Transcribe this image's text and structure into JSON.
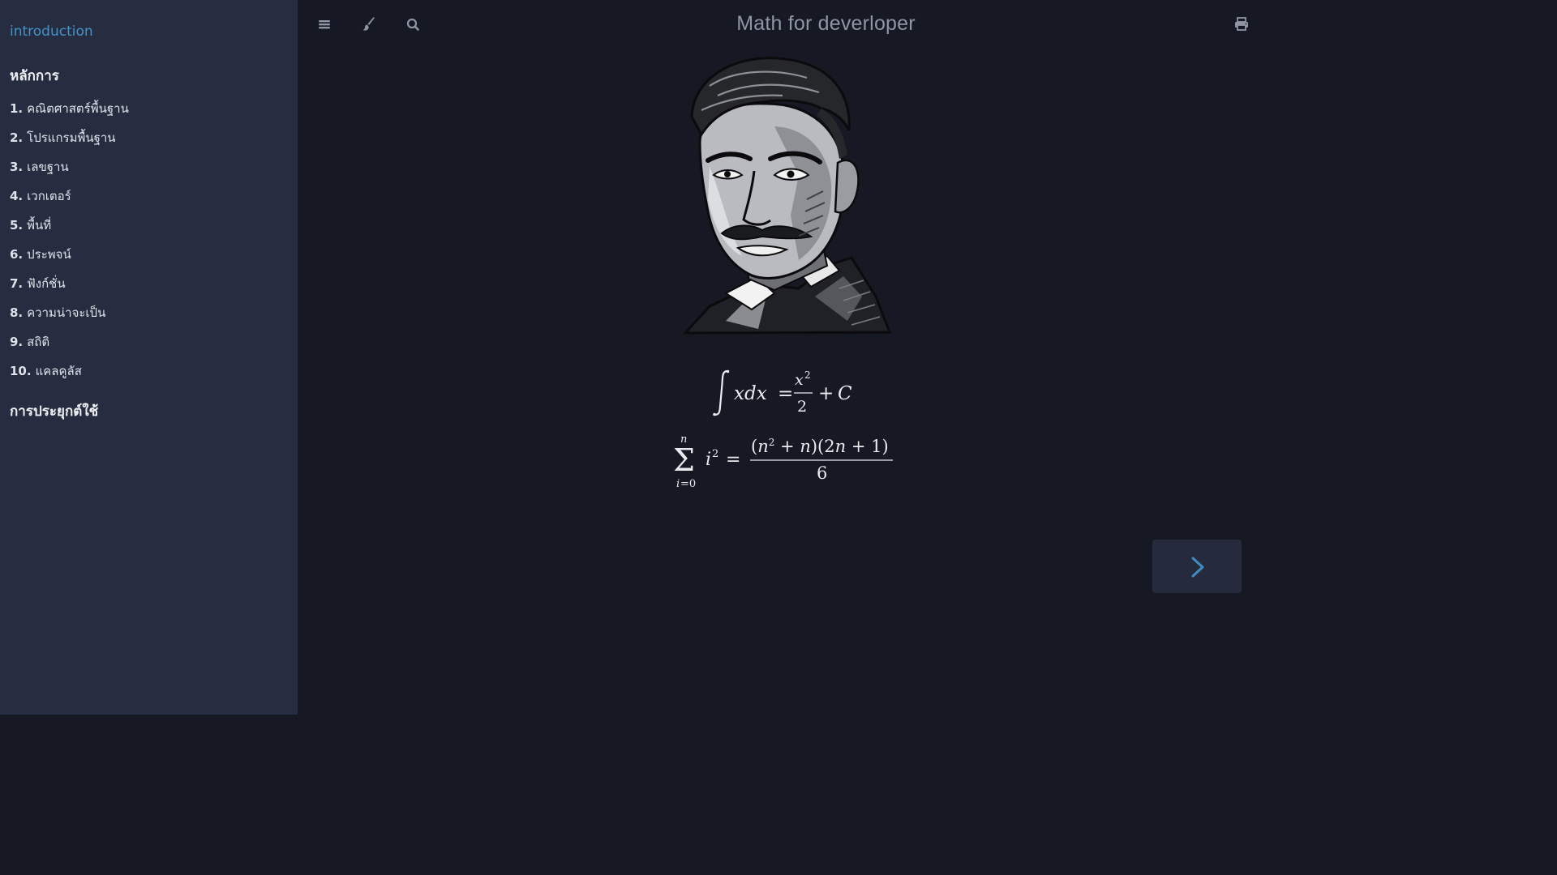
{
  "sidebar": {
    "intro_link": "introduction",
    "section_principles": "หลักการ",
    "chapters": [
      {
        "num": "1.",
        "title": "คณิตศาสตร์พื้นฐาน"
      },
      {
        "num": "2.",
        "title": "โปรแกรมพื้นฐาน"
      },
      {
        "num": "3.",
        "title": "เลขฐาน"
      },
      {
        "num": "4.",
        "title": "เวกเตอร์"
      },
      {
        "num": "5.",
        "title": "พื้นที่"
      },
      {
        "num": "6.",
        "title": "ประพจน์"
      },
      {
        "num": "7.",
        "title": "ฟังก์ชั่น"
      },
      {
        "num": "8.",
        "title": "ความน่าจะเป็น"
      },
      {
        "num": "9.",
        "title": "สถิติ"
      },
      {
        "num": "10.",
        "title": "แคลคูลัส"
      }
    ],
    "section_applications": "การประยุกต์ใช้"
  },
  "header": {
    "title": "Math for deverloper",
    "icons": [
      "menu-icon",
      "paintbrush-icon",
      "search-icon",
      "print-icon"
    ]
  },
  "content": {
    "image": "tesla-portrait-illustration",
    "formulas": [
      "∫ x dx = x²/2 + C",
      "Σ_{i=0}^{n} i² = (n² + n)(2n + 1) / 6"
    ]
  },
  "navigation": {
    "next_icon": "chevron-right-icon"
  },
  "colors": {
    "sidebar_bg": "#272d40",
    "main_bg": "#161923",
    "link": "#4392c9",
    "title": "#8e95a5",
    "next_button_bg": "#252b3c"
  }
}
